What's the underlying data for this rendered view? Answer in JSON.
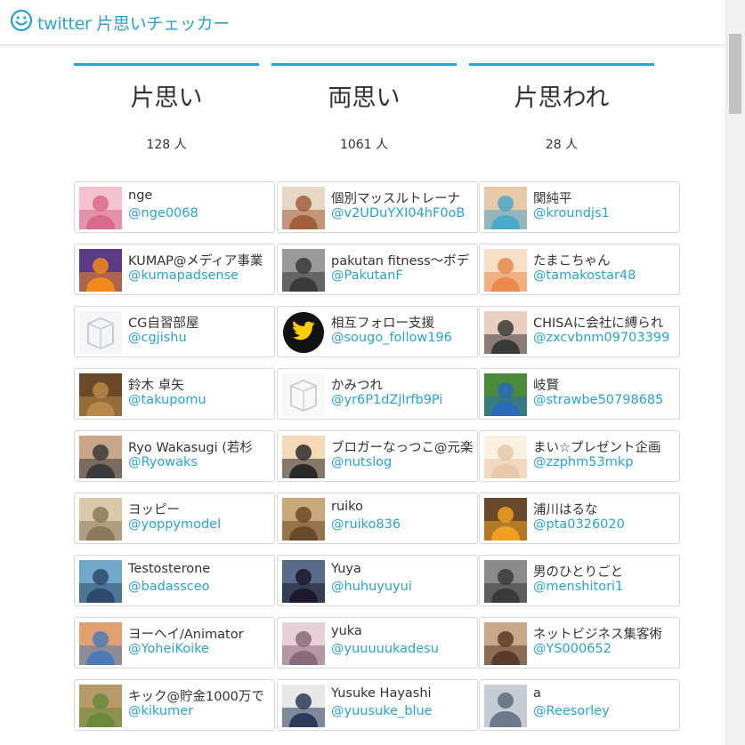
{
  "app": {
    "title": "twitter 片思いチェッカー",
    "icon": "smiley-icon",
    "accent": "#2aa3cc"
  },
  "columns": [
    {
      "title": "片思い",
      "count": "128 人",
      "users": [
        {
          "name": "nge",
          "handle": "@nge0068",
          "avatar": "pink-bear",
          "c1": "#d86a8a",
          "c2": "#f2c2cf"
        },
        {
          "name": "KUMAP@メディア事業",
          "handle": "@kumapadsense",
          "avatar": "halloween",
          "c1": "#f08a1c",
          "c2": "#5b3a86"
        },
        {
          "name": "CG自習部屋",
          "handle": "@cgjishu",
          "avatar": "desk",
          "c1": "#c9ced6",
          "c2": "#f4f5f7"
        },
        {
          "name": "鈴木 卓矢",
          "handle": "@takupomu",
          "avatar": "photo",
          "c1": "#b8884a",
          "c2": "#6b4a2a"
        },
        {
          "name": "Ryo Wakasugi (若杉",
          "handle": "@Ryowaks",
          "avatar": "photo",
          "c1": "#3a3a3a",
          "c2": "#c9a58a"
        },
        {
          "name": "ヨッピー",
          "handle": "@yoppymodel",
          "avatar": "photo",
          "c1": "#8a7a5a",
          "c2": "#d9c9a8"
        },
        {
          "name": "Testosterone",
          "handle": "@badassceo",
          "avatar": "photo",
          "c1": "#2e4a6a",
          "c2": "#6fa8c9"
        },
        {
          "name": "ヨーヘイ/Animator",
          "handle": "@YoheiKoike",
          "avatar": "photo",
          "c1": "#4a7ab8",
          "c2": "#e0a070"
        },
        {
          "name": "キック@貯金1000万で",
          "handle": "@kikumer",
          "avatar": "photo",
          "c1": "#6a8a3a",
          "c2": "#b89a6a"
        }
      ]
    },
    {
      "title": "両思い",
      "count": "1061 人",
      "users": [
        {
          "name": "個別マッスルトレーナ",
          "handle": "@v2UDuYXI04hF0oB",
          "avatar": "photo",
          "c1": "#a0603a",
          "c2": "#e8d8c8"
        },
        {
          "name": "pakutan fitness～ボデ",
          "handle": "@PakutanF",
          "avatar": "photo",
          "c1": "#3a3a3a",
          "c2": "#9a9a9a"
        },
        {
          "name": "相互フォロー支援",
          "handle": "@sougo_follow196",
          "avatar": "twitter-bird",
          "c1": "#111111",
          "c2": "#ffcc00"
        },
        {
          "name": "かみつれ",
          "handle": "@yr6P1dZjlrfb9Pi",
          "avatar": "sketch",
          "c1": "#c8d0d8",
          "c2": "#f8f8f8"
        },
        {
          "name": "ブロガーなっつこ@元楽",
          "handle": "@nutslog",
          "avatar": "illustration",
          "c1": "#2a2a2a",
          "c2": "#f5d9b8"
        },
        {
          "name": "ruiko",
          "handle": "@ruiko836",
          "avatar": "photo",
          "c1": "#6a4a2a",
          "c2": "#c9a87a"
        },
        {
          "name": "Yuya",
          "handle": "@huhuyuyui",
          "avatar": "photo",
          "c1": "#1a1a2a",
          "c2": "#5a6a8a"
        },
        {
          "name": "yuka",
          "handle": "@yuuuuukadesu",
          "avatar": "photo",
          "c1": "#8a6a7a",
          "c2": "#e8d0d8"
        },
        {
          "name": "Yusuke Hayashi",
          "handle": "@yuusuke_blue",
          "avatar": "photo",
          "c1": "#2a3a5a",
          "c2": "#e8e8e8"
        }
      ]
    },
    {
      "title": "片思われ",
      "count": "28 人",
      "users": [
        {
          "name": "関純平",
          "handle": "@kroundjs1",
          "avatar": "photo",
          "c1": "#4aa8c8",
          "c2": "#e8c8a8"
        },
        {
          "name": "たまこちゃん",
          "handle": "@tamakostar48",
          "avatar": "anime",
          "c1": "#e88a4a",
          "c2": "#f8e0c8"
        },
        {
          "name": "CHISAに会社に縛られ",
          "handle": "@zxcvbnm09703399",
          "avatar": "photo",
          "c1": "#3a3a3a",
          "c2": "#e8d0c0"
        },
        {
          "name": "岐賢",
          "handle": "@strawbe50798685",
          "avatar": "photo",
          "c1": "#2a6ab8",
          "c2": "#4a8a3a"
        },
        {
          "name": "まい☆プレゼント企画",
          "handle": "@zzphm53mkp",
          "avatar": "photo",
          "c1": "#e8c8a8",
          "c2": "#f8f0e0"
        },
        {
          "name": "浦川はるな",
          "handle": "@pta0326020",
          "avatar": "photo",
          "c1": "#f0a020",
          "c2": "#6a4a2a"
        },
        {
          "name": "男のひとりごと",
          "handle": "@menshitori1",
          "avatar": "photo",
          "c1": "#3a3a3a",
          "c2": "#8a8a8a"
        },
        {
          "name": "ネットビジネス集客術",
          "handle": "@YS000652",
          "avatar": "photo",
          "c1": "#5a3a2a",
          "c2": "#c8a888"
        },
        {
          "name": "a",
          "handle": "@Reesorley",
          "avatar": "default-avatar",
          "c1": "#6b7b8c",
          "c2": "#c5ccd4"
        }
      ]
    }
  ]
}
